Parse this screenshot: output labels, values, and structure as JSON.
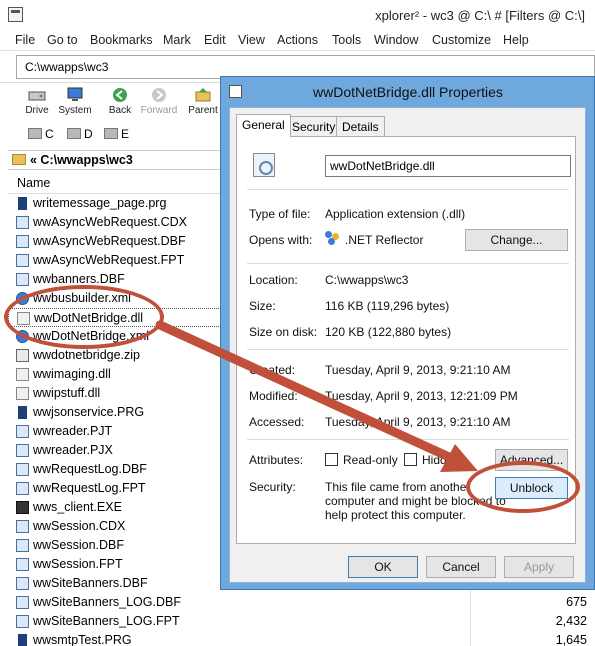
{
  "window": {
    "title": "xplorer² - wc3 @ C:\\ # [Filters @ C:\\]",
    "menu": [
      "File",
      "Go to",
      "Bookmarks",
      "Mark",
      "Edit",
      "View",
      "Actions",
      "Tools",
      "Window",
      "Customize",
      "Help"
    ],
    "address": "C:\\wwapps\\wc3",
    "toolbar": [
      {
        "label": "Drive",
        "icon": "drive-icon"
      },
      {
        "label": "System",
        "icon": "computer-icon"
      },
      {
        "label": "Back",
        "icon": "back-icon"
      },
      {
        "label": "Forward",
        "icon": "forward-icon"
      },
      {
        "label": "Parent",
        "icon": "parent-icon"
      }
    ],
    "drives": [
      "C",
      "D",
      "E"
    ],
    "path": "« C:\\wwapps\\wc3",
    "column_name": "Name"
  },
  "files": [
    {
      "name": "writemessage_page.prg",
      "type": "prg",
      "size": ""
    },
    {
      "name": "wwAsyncWebRequest.CDX",
      "type": "data",
      "size": ""
    },
    {
      "name": "wwAsyncWebRequest.DBF",
      "type": "data",
      "size": ""
    },
    {
      "name": "wwAsyncWebRequest.FPT",
      "type": "data",
      "size": ""
    },
    {
      "name": "wwbanners.DBF",
      "type": "data",
      "size": ""
    },
    {
      "name": "wwbusbuilder.xml",
      "type": "xml",
      "size": ""
    },
    {
      "name": "wwDotNetBridge.dll",
      "type": "dll",
      "size": ""
    },
    {
      "name": "wwDotNetBridge.xml",
      "type": "xml",
      "size": ""
    },
    {
      "name": "wwdotnetbridge.zip",
      "type": "zip",
      "size": ""
    },
    {
      "name": "wwimaging.dll",
      "type": "dll",
      "size": ""
    },
    {
      "name": "wwipstuff.dll",
      "type": "dll",
      "size": ""
    },
    {
      "name": "wwjsonservice.PRG",
      "type": "prg",
      "size": ""
    },
    {
      "name": "wwreader.PJT",
      "type": "data",
      "size": ""
    },
    {
      "name": "wwreader.PJX",
      "type": "data",
      "size": ""
    },
    {
      "name": "wwRequestLog.DBF",
      "type": "data",
      "size": ""
    },
    {
      "name": "wwRequestLog.FPT",
      "type": "data",
      "size": ""
    },
    {
      "name": "wws_client.EXE",
      "type": "exe",
      "size": ""
    },
    {
      "name": "wwSession.CDX",
      "type": "data",
      "size": ""
    },
    {
      "name": "wwSession.DBF",
      "type": "data",
      "size": ""
    },
    {
      "name": "wwSession.FPT",
      "type": "data",
      "size": ""
    },
    {
      "name": "wwSiteBanners.DBF",
      "type": "data",
      "size": ""
    },
    {
      "name": "wwSiteBanners_LOG.DBF",
      "type": "data",
      "size": "675"
    },
    {
      "name": "wwSiteBanners_LOG.FPT",
      "type": "data",
      "size": "2,432"
    },
    {
      "name": "wwsmtpTest.PRG",
      "type": "prg",
      "size": "1,645"
    }
  ],
  "dialog": {
    "title": "wwDotNetBridge.dll Properties",
    "tabs": [
      "General",
      "Security",
      "Details"
    ],
    "filename": "wwDotNetBridge.dll",
    "type_label": "Type of file:",
    "type_value": "Application extension (.dll)",
    "opens_label": "Opens with:",
    "opens_value": ".NET Reflector",
    "change_button": "Change...",
    "location_label": "Location:",
    "location_value": "C:\\wwapps\\wc3",
    "size_label": "Size:",
    "size_value": "116 KB (119,296 bytes)",
    "size_disk_label": "Size on disk:",
    "size_disk_value": "120 KB (122,880 bytes)",
    "created_label": "Created:",
    "created_value": "Tuesday, April 9, 2013, 9:21:10 AM",
    "modified_label": "Modified:",
    "modified_value": "Tuesday, April 9, 2013, 12:21:09 PM",
    "accessed_label": "Accessed:",
    "accessed_value": "Tuesday, April 9, 2013, 9:21:10 AM",
    "attributes_label": "Attributes:",
    "readonly_label": "Read-only",
    "hidden_label": "Hidden",
    "advanced_button": "Advanced...",
    "security_label": "Security:",
    "security_text": [
      "This file came from another",
      "computer and might be blocked to",
      "help protect this computer."
    ],
    "unblock_button": "Unblock",
    "ok_button": "OK",
    "cancel_button": "Cancel",
    "apply_button": "Apply"
  },
  "colors": {
    "annotation": "#c0503a",
    "dialog_frame": "#6ea8dc"
  }
}
